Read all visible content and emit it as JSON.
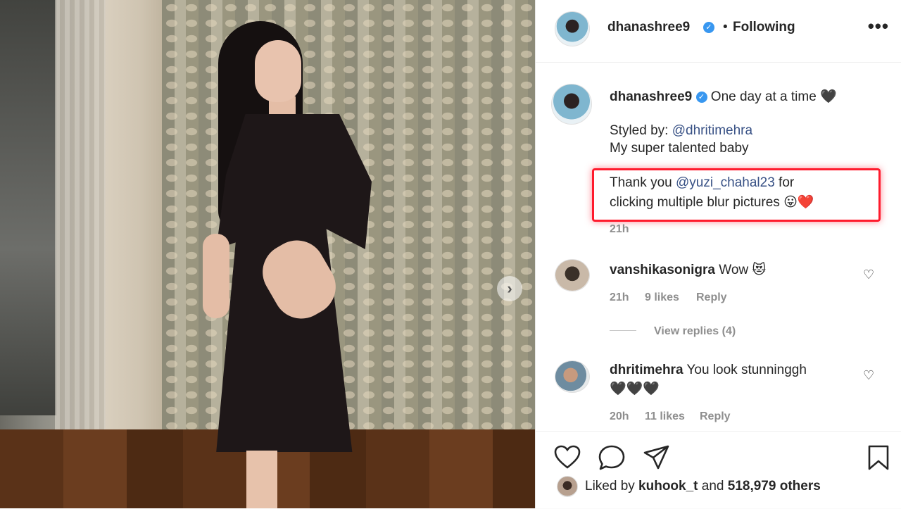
{
  "post": {
    "username": "dhanashree9",
    "separator": "•",
    "follow_status": "Following",
    "more_label": "•••",
    "next_arrow": "›"
  },
  "caption": {
    "username": "dhanashree9",
    "text": "One day at a time",
    "emoji_end": "🖤",
    "styled_by_prefix": "Styled by: ",
    "styled_by_mention": "@dhritimehra",
    "line3": "My super talented baby",
    "thanks_prefix": "Thank you ",
    "thanks_mention": "@yuzi_chahal23",
    "thanks_suffix": " for",
    "thanks_line2": "clicking multiple blur pictures",
    "thanks_emojis": "😛❤️",
    "time": "21h"
  },
  "comments": [
    {
      "username": "vanshikasonigra",
      "text": "Wow",
      "emoji": "😻",
      "time": "21h",
      "likes": "9 likes",
      "reply": "Reply",
      "view_replies": "View replies (4)"
    },
    {
      "username": "dhritimehra",
      "text": "You look stunninggh",
      "line2": "🖤🖤🖤",
      "time": "20h",
      "likes": "11 likes",
      "reply": "Reply"
    }
  ],
  "likes": {
    "prefix": "Liked by ",
    "user": "kuhook_t",
    "middle": " and ",
    "count": "518,979 others"
  },
  "icons": {
    "verified": "✓",
    "heart_small": "♡"
  },
  "colors": {
    "link": "#385185",
    "highlight": "#ff1b2d",
    "verified": "#3897f0",
    "muted": "#8e8e8e"
  }
}
